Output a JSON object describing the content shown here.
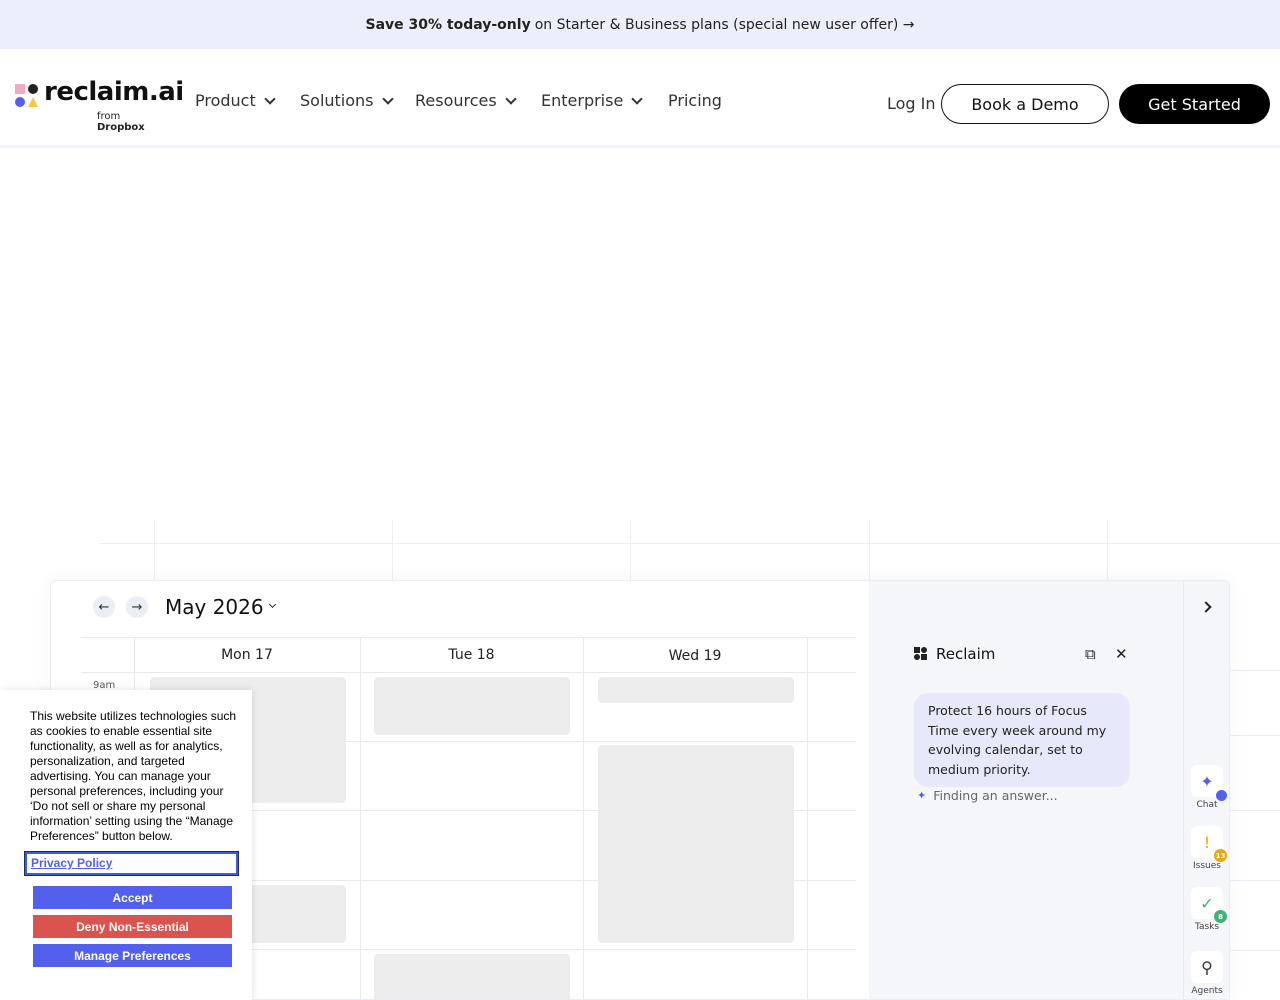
{
  "promo": {
    "bold": "Save 30% today-only",
    "rest": "on Starter & Business plans (special new user offer) →"
  },
  "nav": {
    "logo_text": "reclaim.ai",
    "logo_from": "from",
    "logo_brand": "Dropbox",
    "items": [
      {
        "label": "Product",
        "dropdown": true
      },
      {
        "label": "Solutions",
        "dropdown": true
      },
      {
        "label": "Resources",
        "dropdown": true
      },
      {
        "label": "Enterprise",
        "dropdown": true
      },
      {
        "label": "Pricing",
        "dropdown": false
      }
    ],
    "login": "Log In",
    "demo": "Book a Demo",
    "start": "Get Started"
  },
  "calendar": {
    "month": "May 2026",
    "prev_icon": "←",
    "next_icon": "→",
    "days": [
      "Mon 17",
      "Tue 18",
      "Wed 19"
    ],
    "hour": "9am"
  },
  "assistant": {
    "title": "Reclaim",
    "chat_icon": "⧉",
    "close_icon": "✕",
    "message": "Protect 16 hours of Focus Time every week around my evolving calendar, set to medium priority.",
    "status": "Finding an answer...",
    "status_icon": "✦"
  },
  "rail": {
    "items": [
      {
        "label": "Chat",
        "icon": "✦",
        "badge": ""
      },
      {
        "label": "Issues",
        "icon": "!",
        "badge": "13"
      },
      {
        "label": "Tasks",
        "icon": "✓",
        "badge": "8"
      },
      {
        "label": "Agents",
        "icon": "⚲",
        "badge": ""
      }
    ]
  },
  "cookie": {
    "text": "This website utilizes technologies such as cookies to enable essential site functionality, as well as for analytics, personalization, and targeted advertising. You can manage your personal preferences, including your ‘Do not sell or share my personal information’ setting using the “Manage Preferences” button below.",
    "privacy": "Privacy Policy",
    "accept": "Accept",
    "deny": "Deny Non-Essential",
    "manage": "Manage Preferences"
  },
  "colors": {
    "accent": "#5360ee",
    "deny": "#d9534f",
    "issues_badge": "#e3a912",
    "tasks_badge": "#43b07a"
  }
}
